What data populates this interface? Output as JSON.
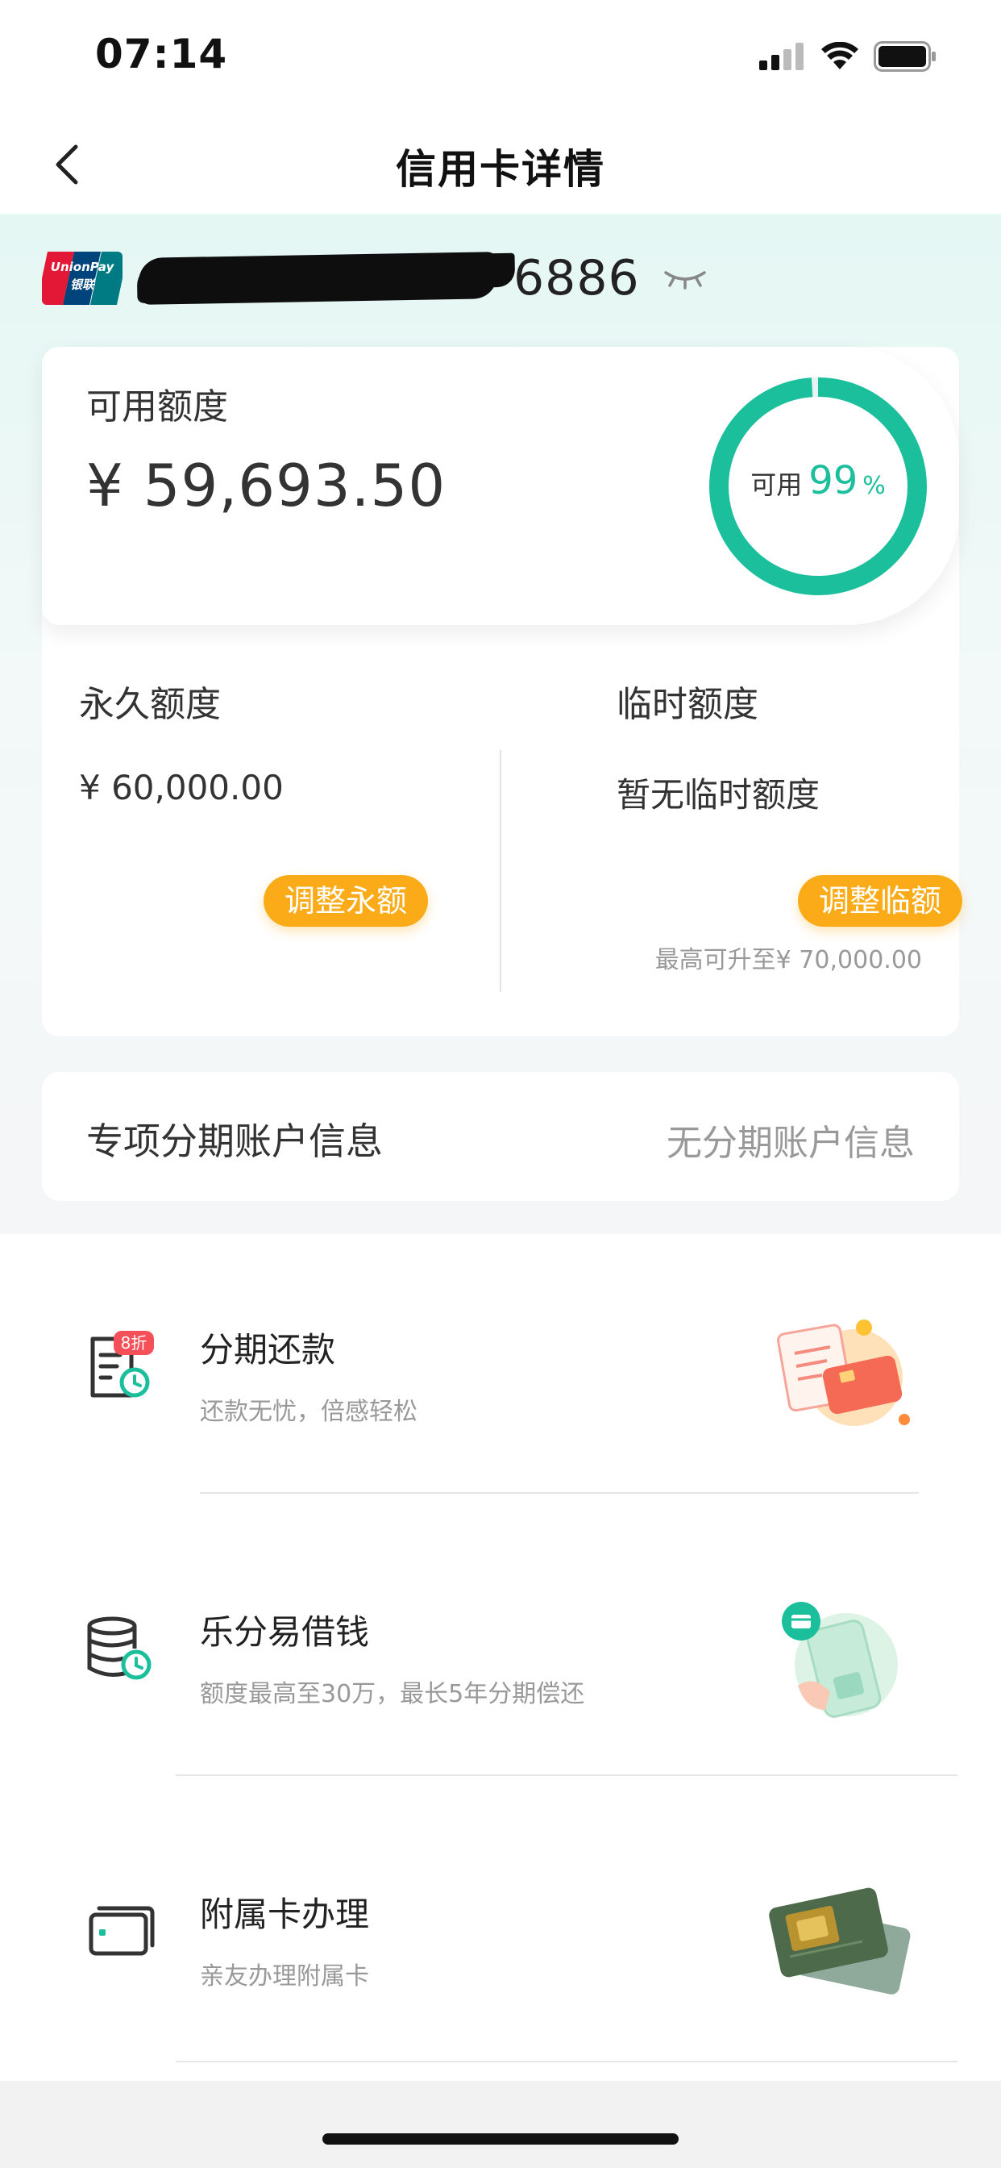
{
  "status_bar": {
    "time": "07:14",
    "icons": [
      "cellular-signal-icon",
      "wifi-icon",
      "battery-icon"
    ]
  },
  "nav": {
    "title": "信用卡详情",
    "back_icon": "chevron-left-icon"
  },
  "card": {
    "brand_logo": "unionpay-logo",
    "brand_text_en": "UnionPay",
    "brand_text_cn": "银联",
    "last4": "6886",
    "visibility_icon": "eye-closed-icon"
  },
  "available": {
    "label": "可用额度",
    "amount": "¥ 59,693.50",
    "ring_label": "可用",
    "ring_percent": "99",
    "ring_unit": "%",
    "ring_fraction": 0.99,
    "accent_color": "#1cbf9c"
  },
  "permanent": {
    "title": "永久额度",
    "value": "¥ 60,000.00",
    "button_label": "调整永额"
  },
  "temporary": {
    "title": "临时额度",
    "value": "暂无临时额度",
    "button_label": "调整临额",
    "max_note": "最高可升至¥ 70,000.00"
  },
  "button_color": "#fbab17",
  "installment_account": {
    "label": "专项分期账户信息",
    "value": "无分期账户信息"
  },
  "services": [
    {
      "title": "分期还款",
      "subtitle": "还款无忧，倍感轻松",
      "icon": "installment-bill-icon",
      "badge": "8折",
      "illustration": "bill-and-card-illustration"
    },
    {
      "title": "乐分易借钱",
      "subtitle": "额度最高至30万，最长5年分期偿还",
      "icon": "coin-stack-clock-icon",
      "illustration": "phone-payment-illustration"
    },
    {
      "title": "附属卡办理",
      "subtitle": "亲友办理附属卡",
      "icon": "card-icon",
      "illustration": "credit-cards-illustration"
    }
  ]
}
